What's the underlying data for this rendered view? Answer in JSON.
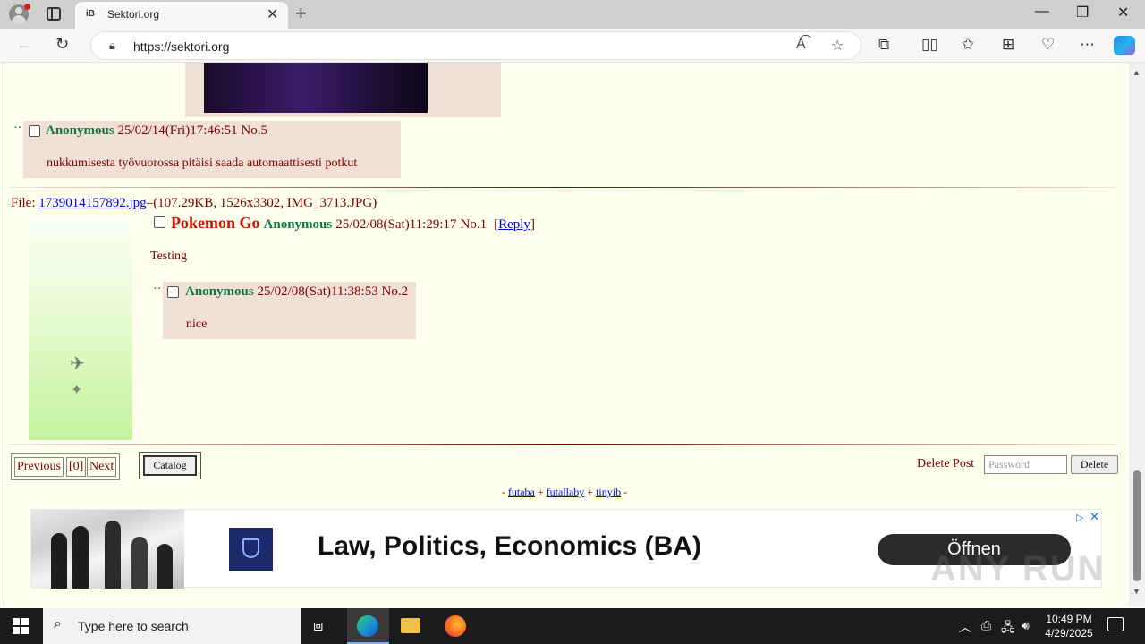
{
  "browser": {
    "tab": {
      "favicon_text": "iB",
      "title": "Sektori.org",
      "close": "✕"
    },
    "new_tab": "+",
    "window": {
      "minimize": "—",
      "maximize": "❐",
      "close": "✕"
    },
    "address": {
      "url": "https://sektori.org"
    },
    "icons": [
      "back-icon",
      "refresh-icon",
      "lock-icon",
      "read-aloud-icon",
      "favorite-icon",
      "extensions-icon",
      "split-screen-icon",
      "favorites-icon",
      "collections-icon",
      "browser-essentials-icon",
      "more-icon",
      "copilot-icon"
    ]
  },
  "page": {
    "post5": {
      "dash": "··",
      "name": "Anonymous",
      "datetime": "25/02/14(Fri)17:46:51",
      "number": "No.5",
      "message": "nukkumisesta työvuorossa pitäisi saada automaattisesti potkut"
    },
    "thread1": {
      "file_label": "File: ",
      "file_link": "1739014157892.jpg",
      "file_info": "–(107.29KB, 1526x3302, IMG_3713.JPG)",
      "subject": "Pokemon Go",
      "name": "Anonymous",
      "datetime": "25/02/08(Sat)11:29:17",
      "number": "No.1",
      "reply_open": "[",
      "reply_link": "Reply",
      "reply_close": "]",
      "message": "Testing",
      "reply": {
        "dash": "··",
        "name": "Anonymous",
        "datetime": "25/02/08(Sat)11:38:53",
        "number": "No.2",
        "message": "nice"
      }
    },
    "pagination": {
      "previous": "Previous",
      "current": "[0]",
      "next": "Next"
    },
    "catalog": "Catalog",
    "delete": {
      "label": "Delete Post",
      "password_placeholder": "Password",
      "button": "Delete"
    },
    "footer": {
      "sep1": "- ",
      "link1": "futaba",
      "sep2": " + ",
      "link2": "futallaby",
      "sep3": " + ",
      "link3": "tinyib",
      "sep4": " -"
    },
    "ad": {
      "title": "Law, Politics, Economics (BA)",
      "cta": "Öffnen",
      "adchoices": "▷",
      "close": "✕"
    },
    "watermark": "ANY RUN"
  },
  "taskbar": {
    "search_placeholder": "Type here to search",
    "time": "10:49 PM",
    "date": "4/29/2025"
  }
}
